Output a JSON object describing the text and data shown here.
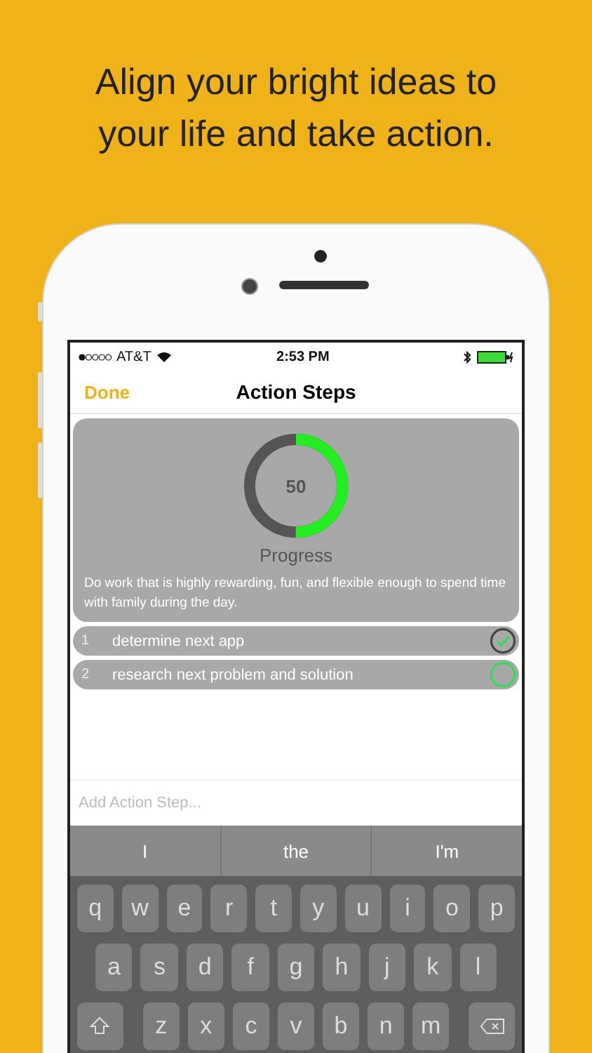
{
  "headline": [
    "Align your bright ideas to",
    "your life and take action."
  ],
  "status_bar": {
    "carrier": "AT&T",
    "time": "2:53 PM"
  },
  "nav": {
    "left": "Done",
    "title": "Action Steps"
  },
  "progress": {
    "value": "50",
    "level": 0.5,
    "label": "Progress"
  },
  "goal": "Do work that is highly rewarding, fun, and flexible enough to spend time with family during the day.",
  "steps": [
    {
      "number": "1",
      "text": "determine next app",
      "checked": true
    },
    {
      "number": "2",
      "text": "research next problem and solution",
      "checked": false
    }
  ],
  "input": {
    "placeholder": "Add Action Step..."
  },
  "suggestions": [
    "I",
    "the",
    "I'm"
  ],
  "keyboard": [
    [
      "q",
      "w",
      "e",
      "r",
      "t",
      "y",
      "u",
      "i",
      "o",
      "p"
    ],
    [
      "a",
      "s",
      "d",
      "f",
      "g",
      "h",
      "j",
      "k",
      "l"
    ],
    [
      "z",
      "x",
      "c",
      "v",
      "b",
      "n",
      "m"
    ]
  ]
}
